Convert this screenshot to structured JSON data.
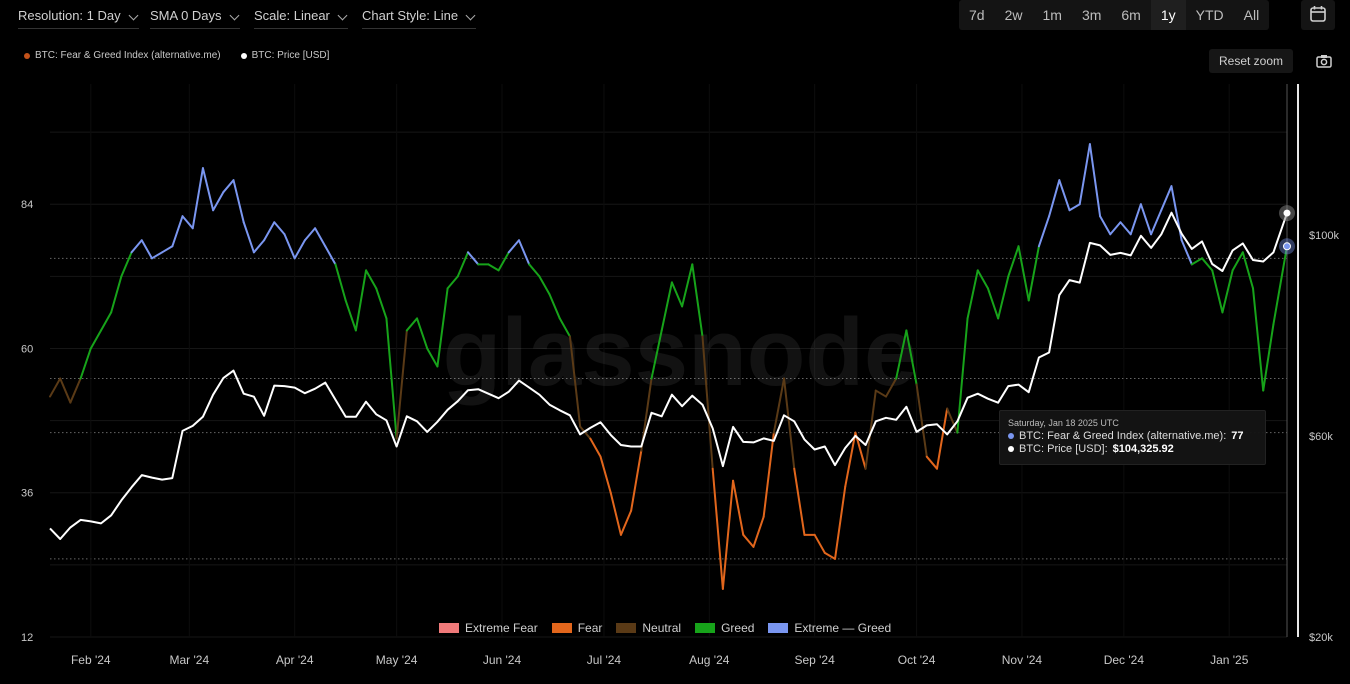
{
  "toolbar": {
    "resolution": "Resolution: 1 Day",
    "sma": "SMA 0 Days",
    "scale": "Scale: Linear",
    "chart_style": "Chart Style: Line",
    "ranges": [
      "7d",
      "2w",
      "1m",
      "3m",
      "6m",
      "1y",
      "YTD",
      "All"
    ],
    "active_range": "1y",
    "calendar_icon": "calendar-icon"
  },
  "legend_top": {
    "fng": "BTC: Fear & Greed Index (alternative.me)",
    "price": "BTC: Price [USD]"
  },
  "reset_zoom": "Reset zoom",
  "camera_icon": "camera-icon",
  "watermark": "glassnode",
  "tooltip": {
    "date": "Saturday, Jan 18 2025 UTC",
    "fng_label": "BTC: Fear & Greed Index (alternative.me):",
    "fng_value": "77",
    "price_label": "BTC: Price [USD]:",
    "price_value": "$104,325.92"
  },
  "colors": {
    "extreme_fear": "#f07a7a",
    "fear": "#e2661c",
    "neutral": "#5a3a16",
    "greed": "#17a31a",
    "extreme_greed": "#7a96f0",
    "price": "#ffffff"
  },
  "chart_data": {
    "type": "line",
    "left_axis": {
      "ticks": [
        12,
        36,
        60,
        84
      ],
      "range": [
        12,
        104
      ]
    },
    "right_axis": {
      "ticks": [
        20000,
        60000,
        100000
      ],
      "tick_labels": [
        "$20k",
        "$60k",
        "$100k"
      ],
      "range": [
        20000,
        130000
      ]
    },
    "x_range": [
      "2024-01-20",
      "2025-01-18"
    ],
    "x_ticks": [
      "2024-02-01",
      "2024-03-01",
      "2024-04-01",
      "2024-05-01",
      "2024-06-01",
      "2024-07-01",
      "2024-08-01",
      "2024-09-01",
      "2024-10-01",
      "2024-11-01",
      "2024-12-01",
      "2025-01-01"
    ],
    "x_tick_labels": [
      "Feb '24",
      "Mar '24",
      "Apr '24",
      "May '24",
      "Jun '24",
      "Jul '24",
      "Aug '24",
      "Sep '24",
      "Oct '24",
      "Nov '24",
      "Dec '24",
      "Jan '25"
    ],
    "zones": [
      {
        "name": "Extreme Fear",
        "range": [
          0,
          25
        ]
      },
      {
        "name": "Fear",
        "range": [
          25,
          46
        ]
      },
      {
        "name": "Neutral",
        "range": [
          46,
          55
        ]
      },
      {
        "name": "Greed",
        "range": [
          55,
          75
        ]
      },
      {
        "name": "Extreme — Greed",
        "range": [
          75,
          100
        ]
      }
    ],
    "series": [
      {
        "name": "BTC: Fear & Greed Index (alternative.me)",
        "axis": "left",
        "points": [
          [
            "2024-01-20",
            52
          ],
          [
            "2024-01-23",
            55
          ],
          [
            "2024-01-26",
            51
          ],
          [
            "2024-01-29",
            55
          ],
          [
            "2024-02-01",
            60
          ],
          [
            "2024-02-04",
            63
          ],
          [
            "2024-02-07",
            66
          ],
          [
            "2024-02-10",
            72
          ],
          [
            "2024-02-13",
            76
          ],
          [
            "2024-02-16",
            78
          ],
          [
            "2024-02-19",
            75
          ],
          [
            "2024-02-22",
            76
          ],
          [
            "2024-02-25",
            77
          ],
          [
            "2024-02-28",
            82
          ],
          [
            "2024-03-02",
            80
          ],
          [
            "2024-03-05",
            90
          ],
          [
            "2024-03-08",
            83
          ],
          [
            "2024-03-11",
            86
          ],
          [
            "2024-03-14",
            88
          ],
          [
            "2024-03-17",
            81
          ],
          [
            "2024-03-20",
            76
          ],
          [
            "2024-03-23",
            78
          ],
          [
            "2024-03-26",
            81
          ],
          [
            "2024-03-29",
            79
          ],
          [
            "2024-04-01",
            75
          ],
          [
            "2024-04-04",
            78
          ],
          [
            "2024-04-07",
            80
          ],
          [
            "2024-04-10",
            77
          ],
          [
            "2024-04-13",
            74
          ],
          [
            "2024-04-16",
            68
          ],
          [
            "2024-04-19",
            63
          ],
          [
            "2024-04-22",
            73
          ],
          [
            "2024-04-25",
            70
          ],
          [
            "2024-04-28",
            65
          ],
          [
            "2024-05-01",
            45
          ],
          [
            "2024-05-04",
            63
          ],
          [
            "2024-05-07",
            65
          ],
          [
            "2024-05-10",
            60
          ],
          [
            "2024-05-13",
            57
          ],
          [
            "2024-05-16",
            70
          ],
          [
            "2024-05-19",
            72
          ],
          [
            "2024-05-22",
            76
          ],
          [
            "2024-05-25",
            74
          ],
          [
            "2024-05-28",
            74
          ],
          [
            "2024-05-31",
            73
          ],
          [
            "2024-06-03",
            76
          ],
          [
            "2024-06-06",
            78
          ],
          [
            "2024-06-09",
            74
          ],
          [
            "2024-06-12",
            72
          ],
          [
            "2024-06-15",
            69
          ],
          [
            "2024-06-18",
            65
          ],
          [
            "2024-06-21",
            62
          ],
          [
            "2024-06-24",
            47
          ],
          [
            "2024-06-27",
            45
          ],
          [
            "2024-06-30",
            42
          ],
          [
            "2024-07-03",
            36
          ],
          [
            "2024-07-06",
            29
          ],
          [
            "2024-07-09",
            33
          ],
          [
            "2024-07-12",
            43
          ],
          [
            "2024-07-15",
            55
          ],
          [
            "2024-07-18",
            63
          ],
          [
            "2024-07-21",
            71
          ],
          [
            "2024-07-24",
            67
          ],
          [
            "2024-07-27",
            74
          ],
          [
            "2024-07-30",
            62
          ],
          [
            "2024-08-02",
            40
          ],
          [
            "2024-08-05",
            20
          ],
          [
            "2024-08-08",
            38
          ],
          [
            "2024-08-11",
            29
          ],
          [
            "2024-08-14",
            27
          ],
          [
            "2024-08-17",
            32
          ],
          [
            "2024-08-20",
            46
          ],
          [
            "2024-08-23",
            55
          ],
          [
            "2024-08-26",
            40
          ],
          [
            "2024-08-29",
            29
          ],
          [
            "2024-09-01",
            29
          ],
          [
            "2024-09-04",
            26
          ],
          [
            "2024-09-07",
            25
          ],
          [
            "2024-09-10",
            37
          ],
          [
            "2024-09-13",
            46
          ],
          [
            "2024-09-16",
            40
          ],
          [
            "2024-09-19",
            53
          ],
          [
            "2024-09-22",
            52
          ],
          [
            "2024-09-25",
            55
          ],
          [
            "2024-09-28",
            63
          ],
          [
            "2024-10-01",
            54
          ],
          [
            "2024-10-04",
            42
          ],
          [
            "2024-10-07",
            40
          ],
          [
            "2024-10-10",
            50
          ],
          [
            "2024-10-13",
            46
          ],
          [
            "2024-10-16",
            65
          ],
          [
            "2024-10-19",
            73
          ],
          [
            "2024-10-22",
            70
          ],
          [
            "2024-10-25",
            65
          ],
          [
            "2024-10-28",
            72
          ],
          [
            "2024-10-31",
            77
          ],
          [
            "2024-11-03",
            68
          ],
          [
            "2024-11-06",
            77
          ],
          [
            "2024-11-09",
            82
          ],
          [
            "2024-11-12",
            88
          ],
          [
            "2024-11-15",
            83
          ],
          [
            "2024-11-18",
            84
          ],
          [
            "2024-11-21",
            94
          ],
          [
            "2024-11-24",
            82
          ],
          [
            "2024-11-27",
            79
          ],
          [
            "2024-11-30",
            81
          ],
          [
            "2024-12-03",
            79
          ],
          [
            "2024-12-06",
            84
          ],
          [
            "2024-12-09",
            79
          ],
          [
            "2024-12-12",
            83
          ],
          [
            "2024-12-15",
            87
          ],
          [
            "2024-12-18",
            78
          ],
          [
            "2024-12-21",
            74
          ],
          [
            "2024-12-24",
            75
          ],
          [
            "2024-12-27",
            73
          ],
          [
            "2024-12-30",
            66
          ],
          [
            "2025-01-02",
            73
          ],
          [
            "2025-01-05",
            76
          ],
          [
            "2025-01-08",
            70
          ],
          [
            "2025-01-11",
            53
          ],
          [
            "2025-01-14",
            64
          ],
          [
            "2025-01-18",
            77
          ]
        ]
      },
      {
        "name": "BTC: Price [USD]",
        "axis": "right",
        "points": [
          [
            "2024-01-20",
            41600
          ],
          [
            "2024-01-23",
            39500
          ],
          [
            "2024-01-26",
            41800
          ],
          [
            "2024-01-29",
            43300
          ],
          [
            "2024-02-01",
            43000
          ],
          [
            "2024-02-04",
            42600
          ],
          [
            "2024-02-07",
            44200
          ],
          [
            "2024-02-10",
            47200
          ],
          [
            "2024-02-13",
            49800
          ],
          [
            "2024-02-16",
            52200
          ],
          [
            "2024-02-19",
            51700
          ],
          [
            "2024-02-22",
            51300
          ],
          [
            "2024-02-25",
            51600
          ],
          [
            "2024-02-28",
            61000
          ],
          [
            "2024-03-02",
            62000
          ],
          [
            "2024-03-05",
            63800
          ],
          [
            "2024-03-08",
            68200
          ],
          [
            "2024-03-11",
            71500
          ],
          [
            "2024-03-14",
            73000
          ],
          [
            "2024-03-17",
            68400
          ],
          [
            "2024-03-20",
            67800
          ],
          [
            "2024-03-23",
            64000
          ],
          [
            "2024-03-26",
            70000
          ],
          [
            "2024-03-29",
            69900
          ],
          [
            "2024-04-01",
            69600
          ],
          [
            "2024-04-04",
            68500
          ],
          [
            "2024-04-07",
            69400
          ],
          [
            "2024-04-10",
            70600
          ],
          [
            "2024-04-13",
            67200
          ],
          [
            "2024-04-16",
            63800
          ],
          [
            "2024-04-19",
            63800
          ],
          [
            "2024-04-22",
            66800
          ],
          [
            "2024-04-25",
            64300
          ],
          [
            "2024-04-28",
            63100
          ],
          [
            "2024-05-01",
            57900
          ],
          [
            "2024-05-04",
            63900
          ],
          [
            "2024-05-07",
            62900
          ],
          [
            "2024-05-10",
            60800
          ],
          [
            "2024-05-13",
            62800
          ],
          [
            "2024-05-16",
            65200
          ],
          [
            "2024-05-19",
            66900
          ],
          [
            "2024-05-22",
            69100
          ],
          [
            "2024-05-25",
            69300
          ],
          [
            "2024-05-28",
            68400
          ],
          [
            "2024-05-31",
            67500
          ],
          [
            "2024-06-03",
            68800
          ],
          [
            "2024-06-06",
            71000
          ],
          [
            "2024-06-09",
            69600
          ],
          [
            "2024-06-12",
            68200
          ],
          [
            "2024-06-15",
            66200
          ],
          [
            "2024-06-18",
            65100
          ],
          [
            "2024-06-21",
            64100
          ],
          [
            "2024-06-24",
            60300
          ],
          [
            "2024-06-27",
            61600
          ],
          [
            "2024-06-30",
            62700
          ],
          [
            "2024-07-03",
            60200
          ],
          [
            "2024-07-06",
            58200
          ],
          [
            "2024-07-09",
            57900
          ],
          [
            "2024-07-12",
            57900
          ],
          [
            "2024-07-15",
            64600
          ],
          [
            "2024-07-18",
            63900
          ],
          [
            "2024-07-21",
            68200
          ],
          [
            "2024-07-24",
            65900
          ],
          [
            "2024-07-27",
            68000
          ],
          [
            "2024-07-30",
            66200
          ],
          [
            "2024-08-02",
            61500
          ],
          [
            "2024-08-05",
            54000
          ],
          [
            "2024-08-08",
            61800
          ],
          [
            "2024-08-11",
            58800
          ],
          [
            "2024-08-14",
            58700
          ],
          [
            "2024-08-17",
            59500
          ],
          [
            "2024-08-20",
            59000
          ],
          [
            "2024-08-23",
            64100
          ],
          [
            "2024-08-26",
            62900
          ],
          [
            "2024-08-29",
            59300
          ],
          [
            "2024-09-01",
            57300
          ],
          [
            "2024-09-04",
            57900
          ],
          [
            "2024-09-07",
            54200
          ],
          [
            "2024-09-10",
            57600
          ],
          [
            "2024-09-13",
            60000
          ],
          [
            "2024-09-16",
            58200
          ],
          [
            "2024-09-19",
            62900
          ],
          [
            "2024-09-22",
            63600
          ],
          [
            "2024-09-25",
            63200
          ],
          [
            "2024-09-28",
            65800
          ],
          [
            "2024-10-01",
            60800
          ],
          [
            "2024-10-04",
            62100
          ],
          [
            "2024-10-07",
            62300
          ],
          [
            "2024-10-10",
            60300
          ],
          [
            "2024-10-13",
            62900
          ],
          [
            "2024-10-16",
            67600
          ],
          [
            "2024-10-19",
            68400
          ],
          [
            "2024-10-22",
            67400
          ],
          [
            "2024-10-25",
            66600
          ],
          [
            "2024-10-28",
            69900
          ],
          [
            "2024-10-31",
            70200
          ],
          [
            "2024-11-03",
            68700
          ],
          [
            "2024-11-06",
            75600
          ],
          [
            "2024-11-09",
            76600
          ],
          [
            "2024-11-12",
            88000
          ],
          [
            "2024-11-15",
            91000
          ],
          [
            "2024-11-18",
            90500
          ],
          [
            "2024-11-21",
            98400
          ],
          [
            "2024-11-24",
            97900
          ],
          [
            "2024-11-27",
            96000
          ],
          [
            "2024-11-30",
            96400
          ],
          [
            "2024-12-03",
            95900
          ],
          [
            "2024-12-06",
            99800
          ],
          [
            "2024-12-09",
            97400
          ],
          [
            "2024-12-12",
            100100
          ],
          [
            "2024-12-15",
            104400
          ],
          [
            "2024-12-18",
            100200
          ],
          [
            "2024-12-21",
            97200
          ],
          [
            "2024-12-24",
            98700
          ],
          [
            "2024-12-27",
            94200
          ],
          [
            "2024-12-30",
            92800
          ],
          [
            "2025-01-02",
            96900
          ],
          [
            "2025-01-05",
            98300
          ],
          [
            "2025-01-08",
            95000
          ],
          [
            "2025-01-11",
            94700
          ],
          [
            "2025-01-14",
            96500
          ],
          [
            "2025-01-18",
            104325.92
          ]
        ]
      }
    ]
  },
  "legend_bottom": [
    "Extreme Fear",
    "Fear",
    "Neutral",
    "Greed",
    "Extreme — Greed"
  ]
}
